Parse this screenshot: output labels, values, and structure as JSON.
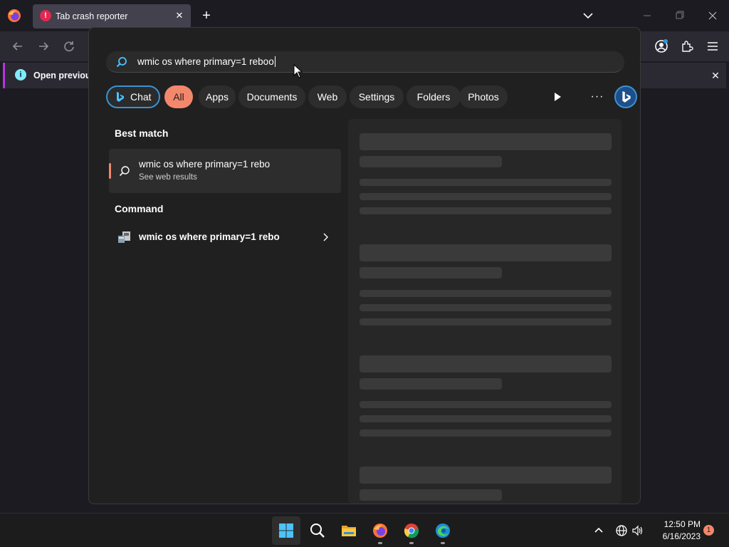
{
  "browser": {
    "tab_title": "Tab crash reporter",
    "tab_close": "✕",
    "new_tab": "+",
    "notification_text": "Open previous",
    "notification_close": "✕"
  },
  "search": {
    "query": "wmic os where primary=1 reboo",
    "filters": [
      {
        "label": "Chat"
      },
      {
        "label": "All"
      },
      {
        "label": "Apps"
      },
      {
        "label": "Documents"
      },
      {
        "label": "Web"
      },
      {
        "label": "Settings"
      },
      {
        "label": "Folders"
      },
      {
        "label": "Photos"
      }
    ],
    "more_label": "···",
    "best_match_heading": "Best match",
    "best_match": {
      "title": "wmic os where primary=1 rebo",
      "subtitle": "See web results"
    },
    "command_heading": "Command",
    "command": {
      "title": "wmic os where primary=1 rebo"
    }
  },
  "taskbar": {
    "time": "12:50 PM",
    "date": "6/16/2023",
    "notification_count": "1"
  },
  "colors": {
    "accent": "#f3876c",
    "chat_border": "#3a92d3"
  }
}
